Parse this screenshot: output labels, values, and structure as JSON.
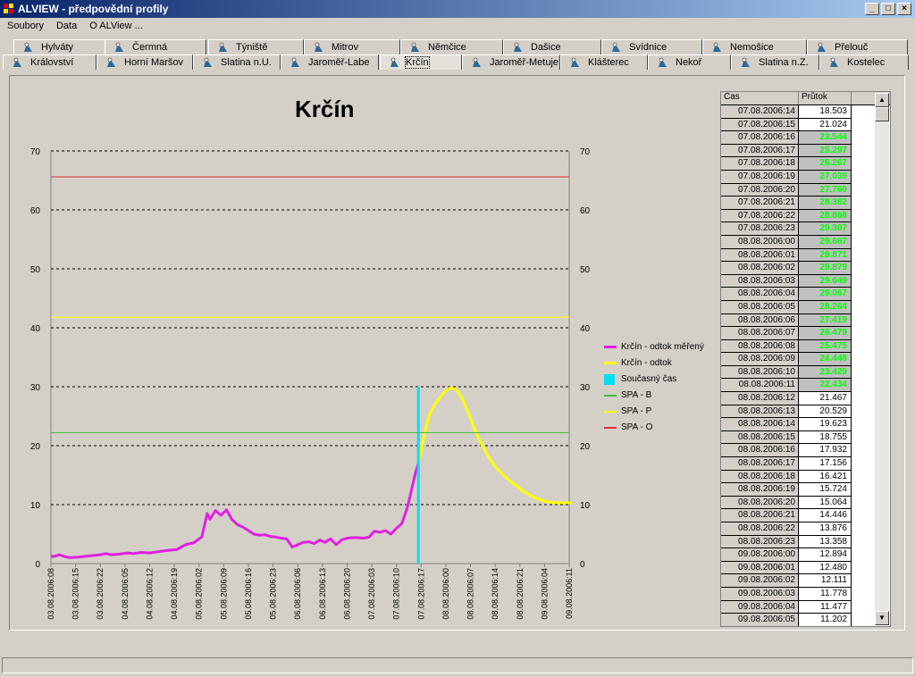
{
  "window": {
    "title": "ALVIEW - předpovědní profily",
    "buttons": [
      "_",
      "□",
      "×"
    ]
  },
  "menu": [
    "Soubory",
    "Data",
    "O ALView ..."
  ],
  "tabs_row1": [
    "Hylváty",
    "Čermná",
    "Týniště",
    "Mitrov",
    "Němčice",
    "Dašice",
    "Svídnice",
    "Nemošice",
    "Přelouč"
  ],
  "tabs_row2": [
    "Království",
    "Horní Maršov",
    "Slatina n.U.",
    "Jaroměř-Labe",
    "Krčín",
    "Jaroměř-Metuje",
    "Klášterec",
    "Nekoř",
    "Slatina n.Z.",
    "Kostelec"
  ],
  "active_tab": "Krčín",
  "chart_data": {
    "type": "line",
    "title": "Krčín",
    "ylim": [
      0,
      70
    ],
    "yticks": [
      0,
      10,
      20,
      30,
      40,
      50,
      60,
      70
    ],
    "grid": "horizontal dotted",
    "legend_position": "right",
    "xtick_labels": [
      "03.08.2006:08",
      "03.08.2006:15",
      "03.08.2006:22",
      "04.08.2006:05",
      "04.08.2006:12",
      "04.08.2006:19",
      "05.08.2006:02",
      "05.08.2006:09",
      "05.08.2006:16",
      "05.08.2006:23",
      "06.08.2006:06",
      "06.08.2006:13",
      "06.08.2006:20",
      "07.08.2006:03",
      "07.08.2006:10",
      "07.08.2006:17",
      "08.08.2006:00",
      "08.08.2006:07",
      "08.08.2006:14",
      "08.08.2006:21",
      "09.08.2006:04",
      "09.08.2006:11"
    ],
    "series": [
      {
        "name": "Krčín - odtok měřený",
        "color": "#e020e0",
        "x": [
          0,
          2,
          3,
          5,
          7,
          10,
          14,
          18,
          20,
          22,
          25,
          28,
          30,
          33,
          36,
          42,
          46,
          49,
          52,
          55,
          56,
          57,
          58,
          60,
          62,
          64,
          66,
          68,
          70,
          72,
          74,
          76,
          78,
          80,
          82,
          84,
          86,
          88,
          90,
          92,
          94,
          96,
          98,
          100,
          102,
          104,
          106,
          108,
          110,
          112,
          114,
          116,
          118,
          120,
          122,
          124,
          126,
          128,
          130,
          131,
          132,
          133,
          134
        ],
        "y": [
          1.2,
          1.3,
          1.5,
          1.2,
          1.0,
          1.1,
          1.3,
          1.5,
          1.7,
          1.5,
          1.6,
          1.8,
          1.7,
          1.9,
          1.8,
          2.2,
          2.4,
          3.2,
          3.5,
          4.5,
          6.5,
          8.5,
          7.5,
          9.0,
          8.2,
          9.1,
          7.5,
          6.6,
          6.2,
          5.6,
          5.0,
          4.8,
          4.9,
          4.6,
          4.5,
          4.3,
          4.2,
          2.8,
          3.2,
          3.6,
          3.7,
          3.4,
          4.0,
          3.6,
          4.2,
          3.2,
          4.0,
          4.3,
          4.4,
          4.4,
          4.3,
          4.5,
          5.5,
          5.3,
          5.6,
          5.0,
          6.0,
          6.8,
          9.5,
          11.5,
          13.5,
          15.5,
          17.0
        ]
      },
      {
        "name": "Krčín - odtok",
        "color": "#ffff00",
        "x": [
          134,
          136,
          138,
          140,
          142,
          144,
          146,
          148,
          150,
          152,
          154,
          156,
          158,
          160,
          162,
          164,
          166,
          168,
          170,
          172,
          174,
          176,
          178,
          180,
          182,
          184,
          186,
          188,
          190
        ],
        "y": [
          17.2,
          21.5,
          25.3,
          27.0,
          28.3,
          29.3,
          29.9,
          29.4,
          28.0,
          25.8,
          23.4,
          21.2,
          19.4,
          17.8,
          16.5,
          15.5,
          14.6,
          13.8,
          13.1,
          12.4,
          11.8,
          11.3,
          10.9,
          10.6,
          10.4,
          10.3,
          10.3,
          10.3,
          10.3
        ]
      },
      {
        "name": "Současný čas",
        "color": "#00e0f0",
        "x": [
          134,
          134
        ],
        "y": [
          0,
          30
        ]
      },
      {
        "name": "SPA - B",
        "color": "#40c040",
        "y_const": 22.2
      },
      {
        "name": "SPA - P",
        "color": "#ffff00",
        "y_const": 41.8
      },
      {
        "name": "SPA - O",
        "color": "#e03030",
        "y_const": 65.6
      }
    ]
  },
  "table": {
    "headers": [
      "Čas",
      "Průtok"
    ],
    "rows": [
      [
        "07.08.2006:14",
        "18.503",
        false
      ],
      [
        "07.08.2006:15",
        "21.024",
        false
      ],
      [
        "07.08.2006:16",
        "23.544",
        true
      ],
      [
        "07.08.2006:17",
        "25.297",
        true
      ],
      [
        "07.08.2006:18",
        "26.267",
        true
      ],
      [
        "07.08.2006:19",
        "27.039",
        true
      ],
      [
        "07.08.2006:20",
        "27.760",
        true
      ],
      [
        "07.08.2006:21",
        "28.382",
        true
      ],
      [
        "07.08.2006:22",
        "28.868",
        true
      ],
      [
        "07.08.2006:23",
        "29.307",
        true
      ],
      [
        "08.08.2006:00",
        "29.667",
        true
      ],
      [
        "08.08.2006:01",
        "29.871",
        true
      ],
      [
        "08.08.2006:02",
        "29.879",
        true
      ],
      [
        "08.08.2006:03",
        "29.649",
        true
      ],
      [
        "08.08.2006:04",
        "29.067",
        true
      ],
      [
        "08.08.2006:05",
        "28.264",
        true
      ],
      [
        "08.08.2006:06",
        "27.419",
        true
      ],
      [
        "08.08.2006:07",
        "26.479",
        true
      ],
      [
        "08.08.2006:08",
        "25.475",
        true
      ],
      [
        "08.08.2006:09",
        "24.448",
        true
      ],
      [
        "08.08.2006:10",
        "23.429",
        true
      ],
      [
        "08.08.2006:11",
        "22.434",
        true
      ],
      [
        "08.08.2006:12",
        "21.467",
        false
      ],
      [
        "08.08.2006:13",
        "20.529",
        false
      ],
      [
        "08.08.2006:14",
        "19.623",
        false
      ],
      [
        "08.08.2006:15",
        "18.755",
        false
      ],
      [
        "08.08.2006:16",
        "17.932",
        false
      ],
      [
        "08.08.2006:17",
        "17.156",
        false
      ],
      [
        "08.08.2006:18",
        "16.421",
        false
      ],
      [
        "08.08.2006:19",
        "15.724",
        false
      ],
      [
        "08.08.2006:20",
        "15.064",
        false
      ],
      [
        "08.08.2006:21",
        "14.446",
        false
      ],
      [
        "08.08.2006:22",
        "13.876",
        false
      ],
      [
        "08.08.2006:23",
        "13.358",
        false
      ],
      [
        "09.08.2006:00",
        "12.894",
        false
      ],
      [
        "09.08.2006:01",
        "12.480",
        false
      ],
      [
        "09.08.2006:02",
        "12.111",
        false
      ],
      [
        "09.08.2006:03",
        "11.778",
        false
      ],
      [
        "09.08.2006:04",
        "11.477",
        false
      ],
      [
        "09.08.2006:05",
        "11.202",
        false
      ]
    ]
  },
  "colors": {
    "highlight_text": "#00ff00",
    "titlebar": "#0a246a"
  }
}
